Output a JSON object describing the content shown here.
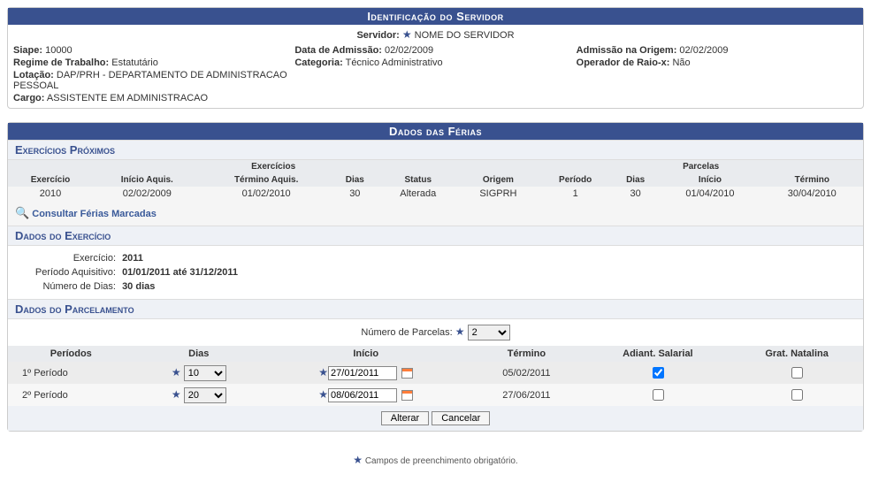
{
  "ident": {
    "header": "Identificação do Servidor",
    "servidor_label": "Servidor:",
    "servidor_nome": "NOME DO SERVIDOR",
    "siape_label": "Siape:",
    "siape": "10000",
    "data_adm_label": "Data de Admissão:",
    "data_adm": "02/02/2009",
    "adm_origem_label": "Admissão na Origem:",
    "adm_origem": "02/02/2009",
    "regime_label": "Regime de Trabalho:",
    "regime": "Estatutário",
    "categoria_label": "Categoria:",
    "categoria": "Técnico Administrativo",
    "raiox_label": "Operador de Raio-x:",
    "raiox": "Não",
    "lotacao_label": "Lotação:",
    "lotacao": "DAP/PRH - DEPARTAMENTO DE ADMINISTRACAO PESSOAL",
    "cargo_label": "Cargo:",
    "cargo": "ASSISTENTE EM ADMINISTRACAO"
  },
  "ferias": {
    "header": "Dados das Férias",
    "sec_prox": "Exercícios Próximos",
    "subhdr_exerc": "Exercícios",
    "subhdr_parc": "Parcelas",
    "cols": {
      "c1": "Exercício",
      "c2": "Início Aquis.",
      "c3": "Término Aquis.",
      "c4": "Dias",
      "c5": "Status",
      "c6": "Origem",
      "c7": "Período",
      "c8": "Dias",
      "c9": "Início",
      "c10": "Término"
    },
    "rows": [
      {
        "c1": "2010",
        "c2": "02/02/2009",
        "c3": "01/02/2010",
        "c4": "30",
        "c5": "Alterada",
        "c6": "SIGPRH",
        "c7": "1",
        "c8": "30",
        "c9": "01/04/2010",
        "c10": "30/04/2010"
      }
    ],
    "link_consultar": "Consultar Férias Marcadas",
    "sec_dex": "Dados do Exercício",
    "dex": {
      "exerc_label": "Exercício:",
      "exerc": "2011",
      "periodo_label": "Período Aquisitivo:",
      "periodo": "01/01/2011 até 31/12/2011",
      "ndias_label": "Número de Dias:",
      "ndias": "30 dias"
    },
    "sec_parc": "Dados do Parcelamento",
    "nparc_label": "Número de Parcelas:",
    "nparc_value": "2",
    "parc_cols": {
      "c1": "Períodos",
      "c2": "Dias",
      "c3": "Início",
      "c4": "Término",
      "c5": "Adiant. Salarial",
      "c6": "Grat. Natalina"
    },
    "parc_rows": [
      {
        "periodo": "1º Período",
        "dias": "10",
        "inicio": "27/01/2011",
        "termino": "05/02/2011",
        "adiant": true,
        "grat": false
      },
      {
        "periodo": "2º Período",
        "dias": "20",
        "inicio": "08/06/2011",
        "termino": "27/06/2011",
        "adiant": false,
        "grat": false
      }
    ]
  },
  "buttons": {
    "alterar": "Alterar",
    "cancelar": "Cancelar"
  },
  "footnote": "Campos de preenchimento obrigatório."
}
